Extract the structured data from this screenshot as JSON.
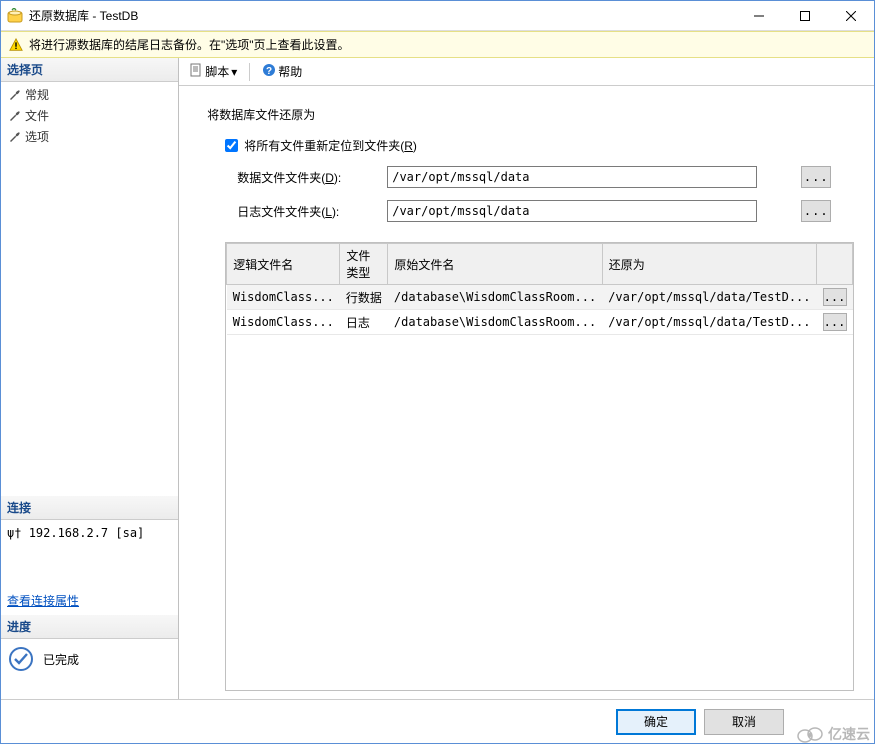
{
  "window": {
    "title": "还原数据库 - TestDB"
  },
  "warning": {
    "text": "将进行源数据库的结尾日志备份。在\"选项\"页上查看此设置。"
  },
  "sidebar": {
    "select_page_header": "选择页",
    "items": [
      {
        "label": "常规"
      },
      {
        "label": "文件"
      },
      {
        "label": "选项"
      }
    ],
    "connection_header": "连接",
    "connection_text": "192.168.2.7 [sa]",
    "view_conn_link": "查看连接属性",
    "progress_header": "进度",
    "progress_text": "已完成"
  },
  "toolbar": {
    "script_label": "脚本",
    "help_label": "帮助"
  },
  "main": {
    "section_title": "将数据库文件还原为",
    "checkbox_label": "将所有文件重新定位到文件夹",
    "checkbox_key": "R",
    "data_folder_label": "数据文件文件夹",
    "data_folder_key": "D",
    "data_folder_value": "/var/opt/mssql/data",
    "log_folder_label": "日志文件文件夹",
    "log_folder_key": "L",
    "log_folder_value": "/var/opt/mssql/data",
    "browse_label": "...",
    "table": {
      "headers": [
        "逻辑文件名",
        "文件类型",
        "原始文件名",
        "还原为",
        ""
      ],
      "rows": [
        {
          "logical": "WisdomClass...",
          "type": "行数据",
          "original": "/database\\WisdomClassRoom...",
          "restore": "/var/opt/mssql/data/TestD..."
        },
        {
          "logical": "WisdomClass...",
          "type": "日志",
          "original": "/database\\WisdomClassRoom...",
          "restore": "/var/opt/mssql/data/TestD..."
        }
      ]
    }
  },
  "footer": {
    "ok_label": "确定",
    "cancel_label": "取消"
  },
  "watermark": "亿速云"
}
